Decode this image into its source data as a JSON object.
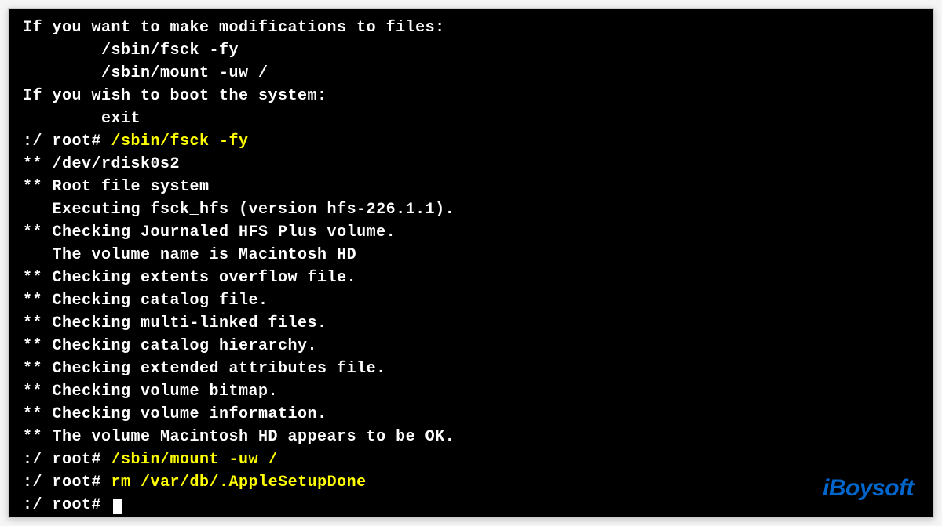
{
  "terminal": {
    "lines": [
      {
        "segments": [
          {
            "text": "If you want to make modifications to files:",
            "color": "white"
          }
        ]
      },
      {
        "segments": [
          {
            "text": "        /sbin/fsck -fy",
            "color": "white"
          }
        ]
      },
      {
        "segments": [
          {
            "text": "        /sbin/mount -uw /",
            "color": "white"
          }
        ]
      },
      {
        "segments": [
          {
            "text": "If you wish to boot the system:",
            "color": "white"
          }
        ]
      },
      {
        "segments": [
          {
            "text": "        exit",
            "color": "white"
          }
        ]
      },
      {
        "segments": [
          {
            "text": ":/ root# ",
            "color": "white"
          },
          {
            "text": "/sbin/fsck -fy",
            "color": "yellow"
          }
        ]
      },
      {
        "segments": [
          {
            "text": "** /dev/rdisk0s2",
            "color": "white"
          }
        ]
      },
      {
        "segments": [
          {
            "text": "** Root file system",
            "color": "white"
          }
        ]
      },
      {
        "segments": [
          {
            "text": "   Executing fsck_hfs (version hfs-226.1.1).",
            "color": "white"
          }
        ]
      },
      {
        "segments": [
          {
            "text": "** Checking Journaled HFS Plus volume.",
            "color": "white"
          }
        ]
      },
      {
        "segments": [
          {
            "text": "   The volume name is Macintosh HD",
            "color": "white"
          }
        ]
      },
      {
        "segments": [
          {
            "text": "** Checking extents overflow file.",
            "color": "white"
          }
        ]
      },
      {
        "segments": [
          {
            "text": "** Checking catalog file.",
            "color": "white"
          }
        ]
      },
      {
        "segments": [
          {
            "text": "** Checking multi-linked files.",
            "color": "white"
          }
        ]
      },
      {
        "segments": [
          {
            "text": "** Checking catalog hierarchy.",
            "color": "white"
          }
        ]
      },
      {
        "segments": [
          {
            "text": "** Checking extended attributes file.",
            "color": "white"
          }
        ]
      },
      {
        "segments": [
          {
            "text": "** Checking volume bitmap.",
            "color": "white"
          }
        ]
      },
      {
        "segments": [
          {
            "text": "** Checking volume information.",
            "color": "white"
          }
        ]
      },
      {
        "segments": [
          {
            "text": "** The volume Macintosh HD appears to be OK.",
            "color": "white"
          }
        ]
      },
      {
        "segments": [
          {
            "text": ":/ root# ",
            "color": "white"
          },
          {
            "text": "/sbin/mount -uw /",
            "color": "yellow"
          }
        ]
      },
      {
        "segments": [
          {
            "text": ":/ root# ",
            "color": "white"
          },
          {
            "text": "rm /var/db/.AppleSetupDone",
            "color": "yellow"
          }
        ]
      },
      {
        "segments": [
          {
            "text": ":/ root# ",
            "color": "white"
          }
        ],
        "cursor": true
      }
    ]
  },
  "watermark": {
    "text": "iBoysoft"
  }
}
